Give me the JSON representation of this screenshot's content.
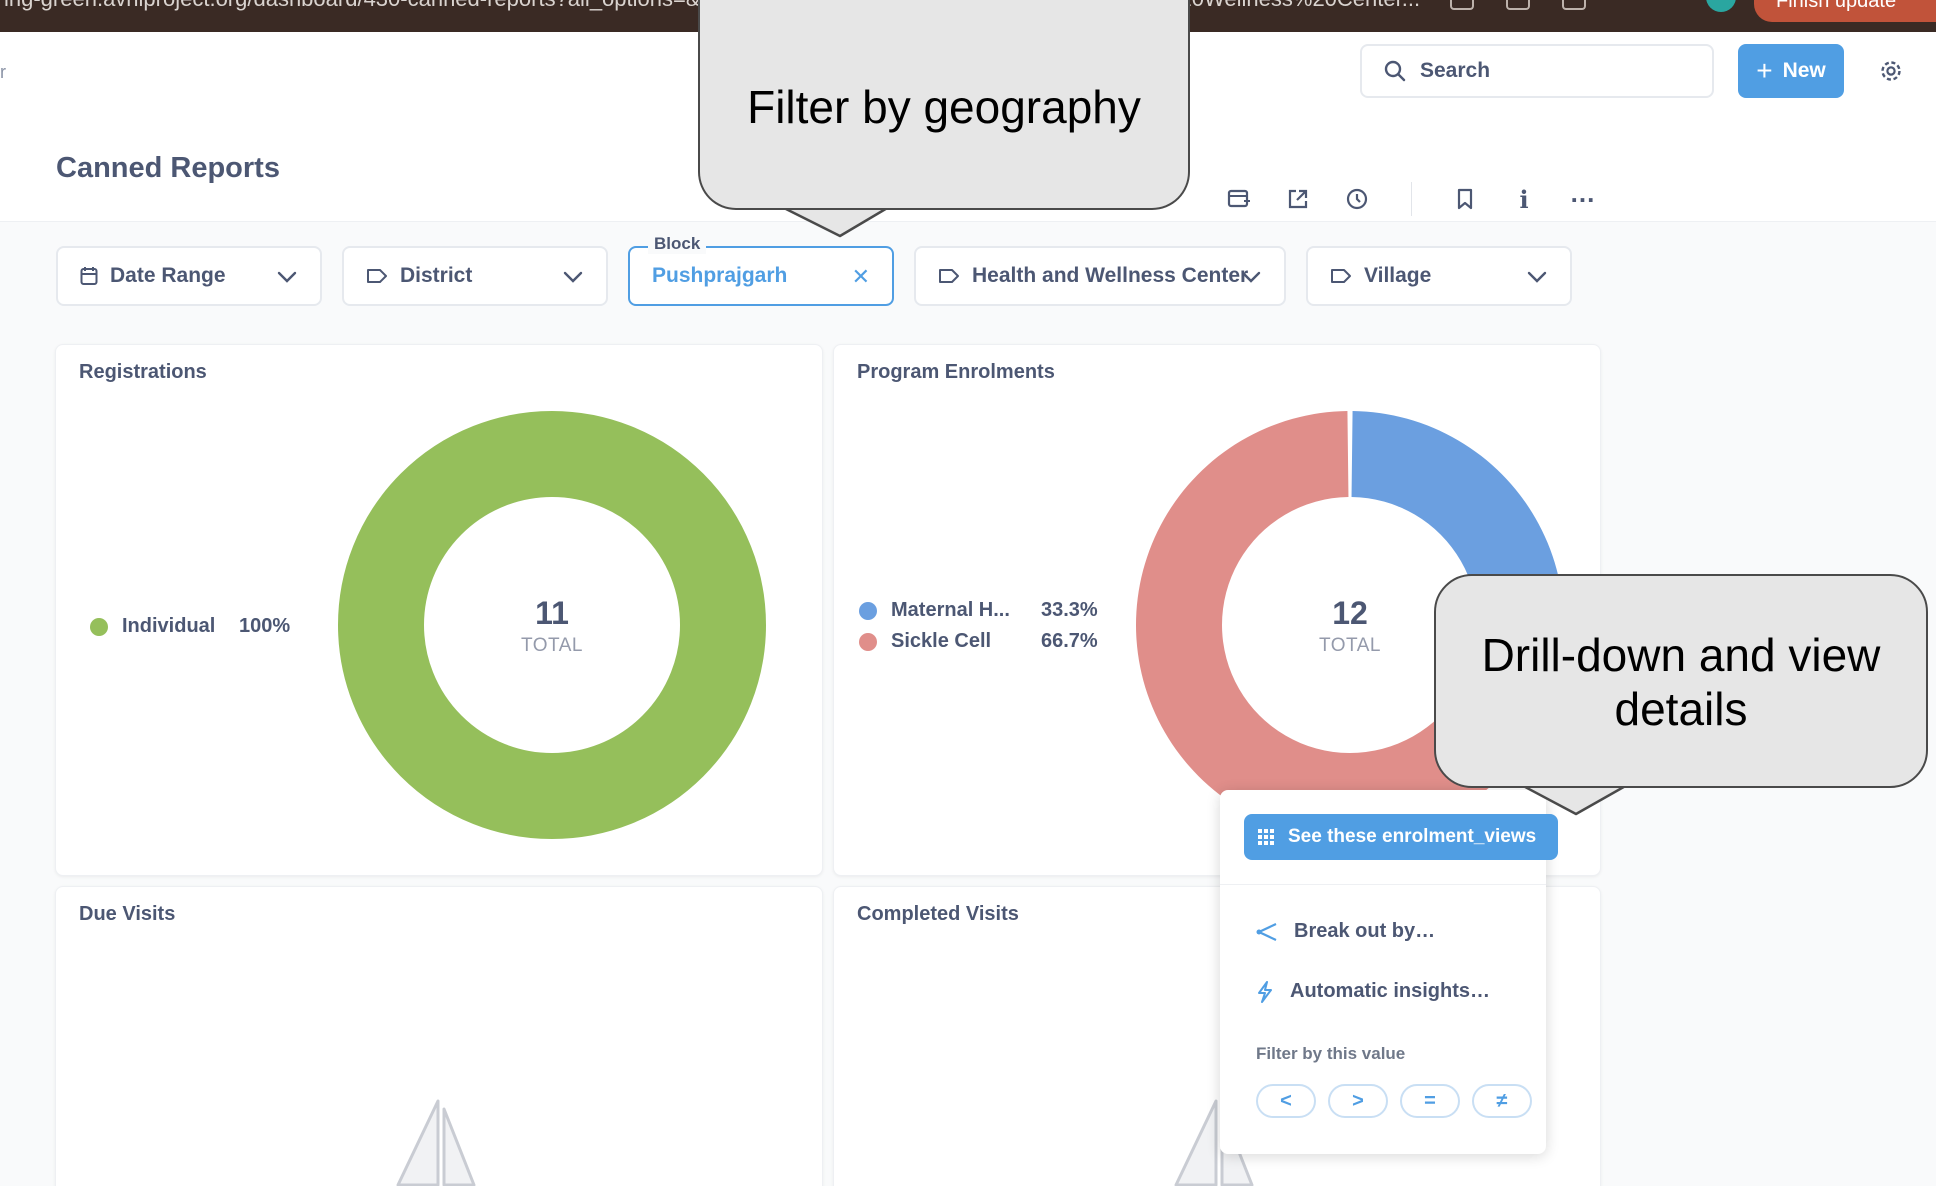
{
  "browser": {
    "url_fragment": "ing-green.avniproject.org/dashboard/430-canned-reports?all_options=&",
    "url_right_fragment": "%20Wellness%20Center...",
    "update_label": "Finish update"
  },
  "header": {
    "left_glyph": "r",
    "search_label": "Search",
    "new_label": "New",
    "page_title": "Canned Reports"
  },
  "filters": {
    "date_range": "Date Range",
    "district": "District",
    "block_legend": "Block",
    "block_value": "Pushprajgarh",
    "hwc": "Health and Wellness Center",
    "village": "Village"
  },
  "cards": {
    "registrations": {
      "title": "Registrations",
      "total": "11",
      "total_label": "TOTAL",
      "legend": [
        {
          "label": "Individual",
          "pct": "100%"
        }
      ]
    },
    "program_enrolments": {
      "title": "Program Enrolments",
      "total": "12",
      "total_label": "TOTAL",
      "legend": [
        {
          "label": "Maternal H...",
          "pct": "33.3%"
        },
        {
          "label": "Sickle Cell",
          "pct": "66.7%"
        }
      ]
    },
    "due_visits": {
      "title": "Due Visits"
    },
    "completed_visits": {
      "title": "Completed Visits"
    }
  },
  "chart_data": [
    {
      "type": "pie",
      "title": "Registrations",
      "categories": [
        "Individual"
      ],
      "values": [
        11
      ],
      "percentages": [
        "100%"
      ],
      "colors": [
        "#95bf5b"
      ],
      "center_value": "11",
      "center_label": "TOTAL"
    },
    {
      "type": "pie",
      "title": "Program Enrolments",
      "categories": [
        "Maternal H...",
        "Sickle Cell"
      ],
      "values": [
        4,
        8
      ],
      "percentages": [
        "33.3%",
        "66.7%"
      ],
      "colors": [
        "#6b9fe0",
        "#e08e8a"
      ],
      "center_value": "12",
      "center_label": "TOTAL"
    }
  ],
  "callouts": {
    "filter": "Filter by geography",
    "drill_line1": "Drill-down and view",
    "drill_line2": "details"
  },
  "popover": {
    "primary_action": "See these enrolment_views",
    "break_out": "Break out by…",
    "insights": "Automatic insights…",
    "filter_heading": "Filter by this value",
    "operators": [
      "<",
      ">",
      "=",
      "≠"
    ]
  },
  "colors": {
    "accent": "#509ee3",
    "individual": "#95bf5b",
    "maternal": "#6b9fe0",
    "sickle_cell": "#e08e8a"
  }
}
